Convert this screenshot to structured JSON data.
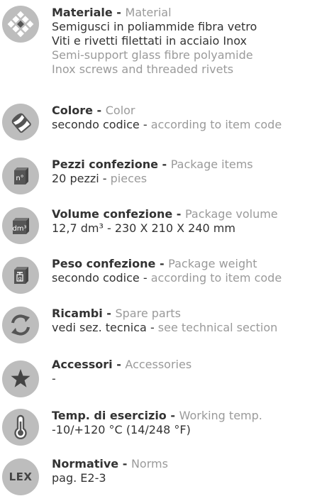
{
  "items": [
    {
      "icon": "material-icon",
      "title_it": "Materiale - ",
      "title_en": "Material",
      "lines": [
        {
          "text": "Semigusci in poliammide fibra vetro"
        },
        {
          "text": "Viti e rivetti filettati in acciaio Inox"
        },
        {
          "text": "Semi-support glass fibre polyamide"
        },
        {
          "text": "Inox screws and threaded rivets"
        }
      ]
    },
    {
      "icon": "paint-bucket-icon",
      "title_it": "Colore - ",
      "title_en": "Color",
      "line_it": "secondo codice - ",
      "line_en": "according to item code"
    },
    {
      "icon": "package-items-icon",
      "icon_label": "n°",
      "title_it": "Pezzi confezione - ",
      "title_en": "Package items",
      "line_it": "20 pezzi - ",
      "line_en": "pieces"
    },
    {
      "icon": "package-volume-icon",
      "icon_label": "dm³",
      "title_it": "Volume confezione - ",
      "title_en": "Package volume",
      "line_it": "12,7 dm³ - 230 X 210 X 240 mm",
      "line_en": ""
    },
    {
      "icon": "package-weight-icon",
      "icon_label": "g",
      "title_it": "Peso confezione - ",
      "title_en": "Package weight",
      "line_it": "secondo codice - ",
      "line_en": "according to item code"
    },
    {
      "icon": "spare-parts-icon",
      "title_it": "Ricambi - ",
      "title_en": "Spare parts",
      "line_it": "vedi sez. tecnica - ",
      "line_en": "see technical section"
    },
    {
      "icon": "star-icon",
      "title_it": "Accessori - ",
      "title_en": "Accessories",
      "line_it": "-",
      "line_en": ""
    },
    {
      "icon": "thermometer-icon",
      "title_it": "Temp. di esercizio - ",
      "title_en": "Working temp.",
      "line_it": "-10/+120 °C (14/248 °F)",
      "line_en": ""
    },
    {
      "icon": "lex-icon",
      "icon_label": "LEX",
      "title_it": "Normative - ",
      "title_en": "Norms",
      "line_it": "pag. E2-3",
      "line_en": ""
    }
  ]
}
